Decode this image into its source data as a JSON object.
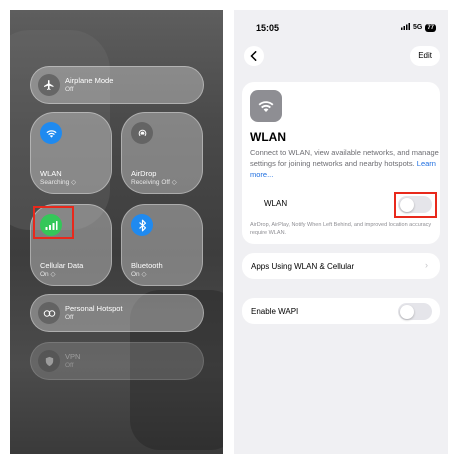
{
  "control_center": {
    "airplane": {
      "title": "Airplane Mode",
      "status": "Off",
      "icon": "airplane-icon"
    },
    "wlan": {
      "title": "WLAN",
      "status": "Searching ◇",
      "icon": "wifi-icon"
    },
    "airdrop": {
      "title": "AirDrop",
      "status": "Receiving Off ◇",
      "icon": "airdrop-icon"
    },
    "cellular": {
      "title": "Cellular Data",
      "status": "On ◇",
      "icon": "cellular-icon"
    },
    "bluetooth": {
      "title": "Bluetooth",
      "status": "On ◇",
      "icon": "bluetooth-icon"
    },
    "hotspot": {
      "title": "Personal Hotspot",
      "status": "Off",
      "icon": "hotspot-icon"
    },
    "vpn": {
      "title": "VPN",
      "status": "Off",
      "icon": "vpn-icon"
    }
  },
  "settings": {
    "status_bar": {
      "time": "15:05",
      "network": "5G",
      "battery": "77"
    },
    "edit_label": "Edit",
    "wlan_title": "WLAN",
    "description": "Connect to WLAN, view available networks, and manage settings for joining networks and nearby hotspots.",
    "learn_more": "Learn more...",
    "wlan_toggle_label": "WLAN",
    "wlan_toggle_on": false,
    "footnote": "AirDrop, AirPlay, Notify When Left Behind, and improved location accuracy require WLAN.",
    "apps_row_label": "Apps Using WLAN & Cellular",
    "wapi_label": "Enable WAPI",
    "wapi_toggle_on": false
  },
  "colors": {
    "highlight": "#e8291c",
    "blue": "#1f8af0",
    "green": "#34c759",
    "link": "#1f6fe0"
  }
}
